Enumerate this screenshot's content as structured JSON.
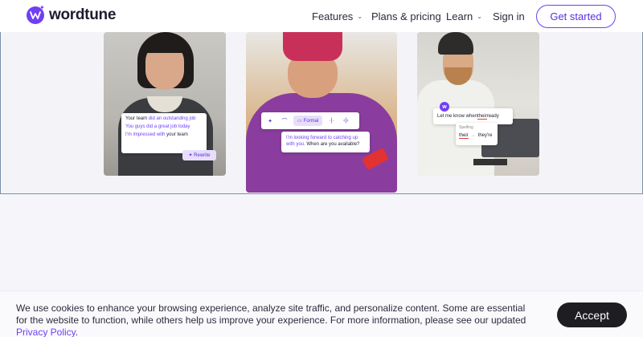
{
  "brand": {
    "name": "wordtune",
    "accent": "#6f3ff5"
  },
  "nav": {
    "features": "Features",
    "plans": "Plans & pricing",
    "learn": "Learn",
    "signin": "Sign in",
    "cta": "Get started"
  },
  "hero": {
    "card1": {
      "line1_a": "Your team ",
      "line1_b": "did an outstanding job",
      "line2": "You guys did a great job today",
      "line3_a": "I'm impressed with",
      "line3_b": " your team",
      "rewrite": "Rewrite"
    },
    "card2": {
      "formal": "Formal",
      "text_a": "I'm looking forward to catching up with you.",
      "text_b": " When are you available?"
    },
    "card3": {
      "badge": "w",
      "text_a": "Let me know when ",
      "text_err": "their",
      "text_b": " ready",
      "spelling_label": "Spelling",
      "from": "their",
      "arrow": "→",
      "to": "they're"
    }
  },
  "cookie": {
    "text": "We use cookies to enhance your browsing experience, analyze site traffic, and personalize content. Some are essential for the website to function, while others help us improve your experience. For more information, please see our updated ",
    "link": "Privacy Policy",
    "end": ".",
    "accept": "Accept"
  },
  "icons": {
    "logo": "wordtune-logo-icon",
    "chevron": "chevron-down-icon",
    "sparkle": "sparkle-icon"
  }
}
